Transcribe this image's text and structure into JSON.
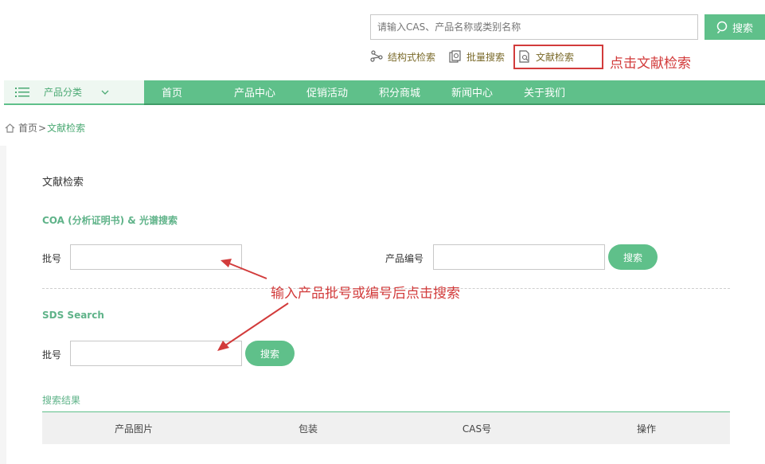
{
  "header": {
    "search_placeholder": "请输入CAS、产品名称或类别名称",
    "search_button": "搜索",
    "tools": [
      {
        "label": "结构式检索",
        "icon": "structure-icon"
      },
      {
        "label": "批量搜索",
        "icon": "batch-icon"
      },
      {
        "label": "文献检索",
        "icon": "document-search-icon"
      }
    ]
  },
  "annotations": {
    "top": "点击文献检索",
    "middle": "输入产品批号或编号后点击搜索"
  },
  "nav": {
    "category_label": "产品分类",
    "items": [
      "首页",
      "产品中心",
      "促销活动",
      "积分商城",
      "新闻中心",
      "关于我们"
    ]
  },
  "breadcrumb": {
    "home": "首页",
    "separator": ">",
    "current": "文献检索"
  },
  "main": {
    "page_title": "文献检索",
    "coa": {
      "title": "COA (分析证明书) & 光谱搜索",
      "batch_label": "批号",
      "product_code_label": "产品编号",
      "search_button": "搜索"
    },
    "sds": {
      "title": "SDS Search",
      "batch_label": "批号",
      "search_button": "搜索"
    },
    "results": {
      "title": "搜索结果",
      "columns": [
        "产品图片",
        "包装",
        "CAS号",
        "操作"
      ]
    }
  },
  "colors": {
    "accent": "#5fc08a",
    "annotation": "#d23b3b"
  }
}
